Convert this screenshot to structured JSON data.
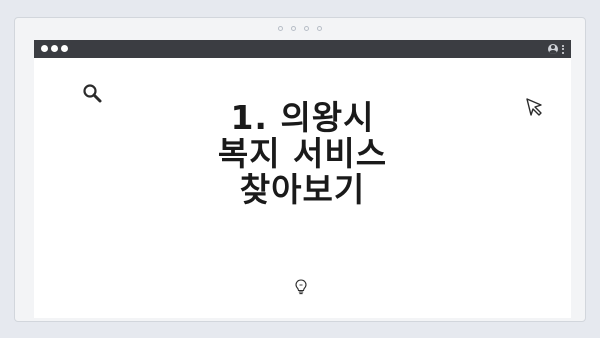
{
  "icons": {
    "search": "search-icon",
    "cursor": "cursor-icon",
    "lightbulb": "lightbulb-icon",
    "user": "user-icon",
    "menu": "kebab-menu-icon"
  },
  "colors": {
    "background": "#e6e9ef",
    "titlebar": "#3b3d42",
    "window": "#ffffff",
    "text": "#1a1a1a"
  },
  "headline": {
    "line1": "1. 의왕시",
    "line2": "복지 서비스",
    "line3": "찾아보기"
  }
}
